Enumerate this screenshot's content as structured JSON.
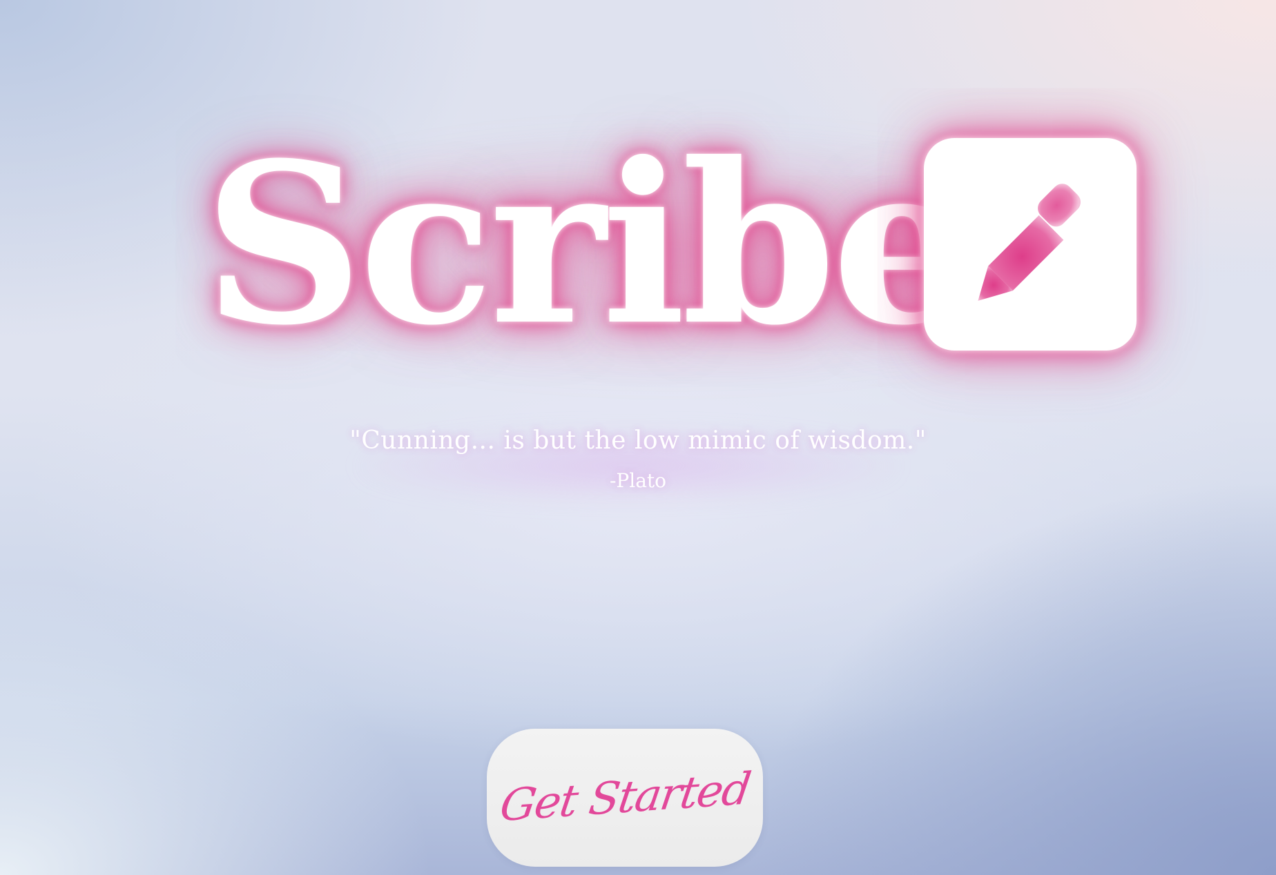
{
  "app": {
    "title": "Scribe"
  },
  "logo": {
    "icon": "pencil-square-icon",
    "tile_color": "#ffffff",
    "glyph_color": "#e2489a"
  },
  "quote": {
    "text": "\"Cunning... is but the low mimic of wisdom.\"",
    "author": "-Plato"
  },
  "cta": {
    "label": "Get Started"
  },
  "colors": {
    "accent": "#e2489a",
    "glow": "#e24e91",
    "background_top": "#dfe2ef",
    "background_bottom": "#a9b6d8"
  }
}
